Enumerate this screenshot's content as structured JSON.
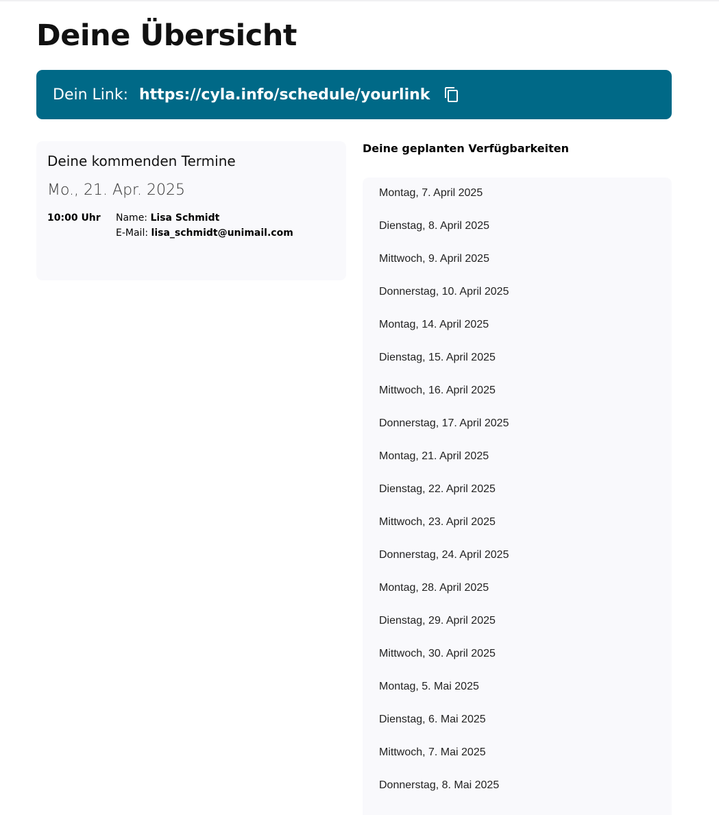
{
  "page": {
    "title": "Deine Übersicht"
  },
  "link_banner": {
    "label": "Dein Link:",
    "url": "https://cyla.info/schedule/yourlink",
    "copy_icon": "copy-icon",
    "background_color": "#006987"
  },
  "appointments": {
    "title": "Deine kommenden Termine",
    "groups": [
      {
        "date": "Mo., 21. Apr. 2025",
        "items": [
          {
            "time": "10:00 Uhr",
            "name_label": "Name:",
            "name": "Lisa Schmidt",
            "email_label": "E-Mail:",
            "email": "lisa_schmidt@unimail.com"
          }
        ]
      }
    ]
  },
  "availability": {
    "title": "Deine geplanten Verfügbarkeiten",
    "dates": [
      "Montag, 7. April 2025",
      "Dienstag, 8. April 2025",
      "Mittwoch, 9. April 2025",
      "Donnerstag, 10. April 2025",
      "Montag, 14. April 2025",
      "Dienstag, 15. April 2025",
      "Mittwoch, 16. April 2025",
      "Donnerstag, 17. April 2025",
      "Montag, 21. April 2025",
      "Dienstag, 22. April 2025",
      "Mittwoch, 23. April 2025",
      "Donnerstag, 24. April 2025",
      "Montag, 28. April 2025",
      "Dienstag, 29. April 2025",
      "Mittwoch, 30. April 2025",
      "Montag, 5. Mai 2025",
      "Dienstag, 6. Mai 2025",
      "Mittwoch, 7. Mai 2025",
      "Donnerstag, 8. Mai 2025"
    ]
  }
}
